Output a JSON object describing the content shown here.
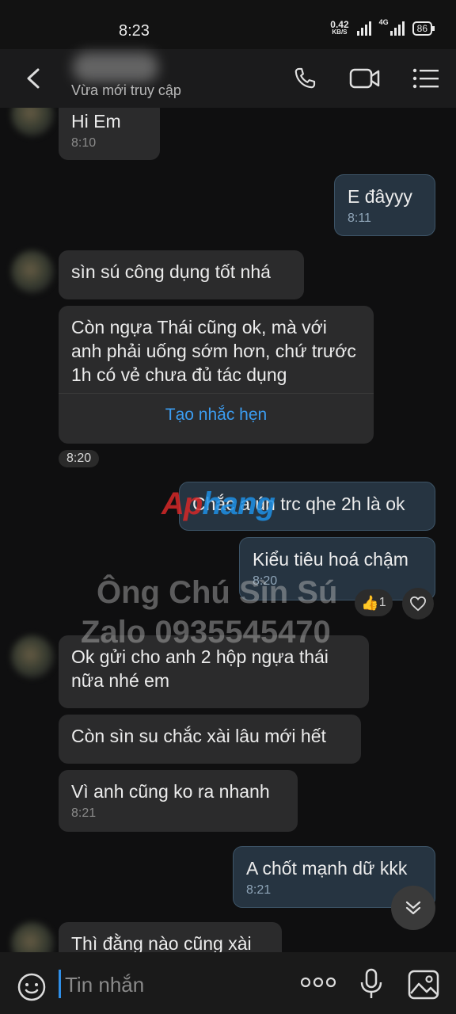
{
  "status_bar": {
    "time": "8:23",
    "net_speed_value": "0.42",
    "net_speed_unit": "KB/S",
    "network": "4G",
    "battery": "86"
  },
  "header": {
    "status_text": "Vừa mới truy cập",
    "icons": [
      "back-arrow-icon",
      "phone-icon",
      "video-call-icon",
      "menu-icon"
    ]
  },
  "messages": [
    {
      "side": "in",
      "text": "Hi Em",
      "time": "8:10"
    },
    {
      "side": "out",
      "text": "E đâyyy",
      "time": "8:11"
    },
    {
      "side": "in",
      "text": "sìn sú công dụng tốt nhá"
    },
    {
      "side": "in",
      "text": "Còn ngựa Thái cũng ok, mà với anh phải uống sớm hơn, chứ trước 1h có vẻ chưa đủ tác dụng",
      "action": "Tạo nhắc hẹn"
    },
    {
      "time_pill": "8:20"
    },
    {
      "side": "out",
      "text": "Chắc a ún trc qhe 2h là ok"
    },
    {
      "side": "out",
      "text": "Kiểu tiêu hoá chậm",
      "time": "8:20",
      "reaction_count": "1"
    },
    {
      "side": "in",
      "text": "Ok gửi cho anh 2 hộp ngựa thái nữa nhé em"
    },
    {
      "side": "in",
      "text": "Còn sìn su chắc xài lâu mới hết"
    },
    {
      "side": "in",
      "text": "Vì anh cũng ko ra nhanh",
      "time": "8:21"
    },
    {
      "side": "out",
      "text": "A chốt mạnh dữ kkk",
      "time": "8:21"
    },
    {
      "side": "in",
      "text": "Thì đằng nào cũng xài"
    }
  ],
  "watermark": {
    "logo_part1": "Ap",
    "logo_part2": "hang",
    "line1": "Ông Chú Sìn Sú",
    "line2": "Zalo 0935545470"
  },
  "input": {
    "placeholder": "Tin nhắn"
  },
  "colors": {
    "background": "#0f0f10",
    "incoming_bubble": "#2b2b2c",
    "outgoing_bubble": "#263441",
    "link_blue": "#3b9cf0"
  }
}
